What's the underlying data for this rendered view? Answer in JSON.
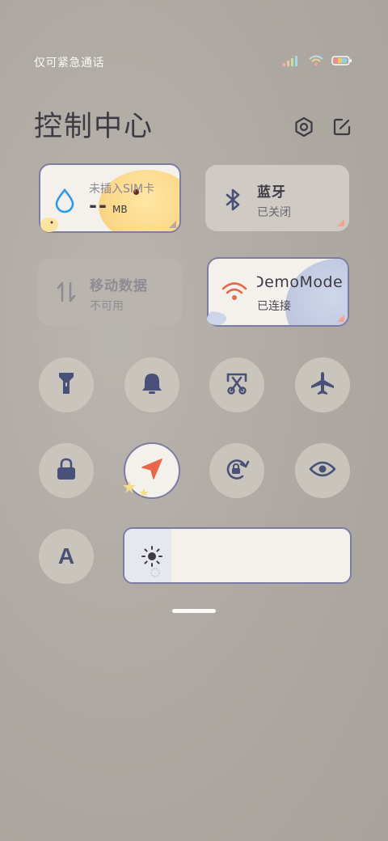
{
  "status": {
    "carrier": "仅可紧急通话",
    "icons": [
      "signal-icon",
      "wifi-icon",
      "battery-icon"
    ]
  },
  "header": {
    "title": "控制中心",
    "settings_icon": "gear-hexagon-icon",
    "edit_icon": "edit-icon"
  },
  "tiles": {
    "data": {
      "label": "未插入SIM卡",
      "value": "--",
      "unit": "MB"
    },
    "bluetooth": {
      "label": "蓝牙",
      "status": "已关闭"
    },
    "mobile_data": {
      "label": "移动数据",
      "status": "不可用"
    },
    "wifi": {
      "label": "DemoMode",
      "status": "已连接"
    }
  },
  "toggles": [
    "flashlight-icon",
    "bell-icon",
    "screenshot-icon",
    "airplane-icon",
    "lock-icon",
    "location-icon",
    "rotation-lock-icon",
    "eye-icon",
    "font-size-icon"
  ],
  "font_toggle_glyph": "A",
  "colors": {
    "accent_blue": "#2f9be8",
    "icon_navy": "#4a5178",
    "wifi_orange": "#e36a4a",
    "location_orange": "#e8674a"
  }
}
